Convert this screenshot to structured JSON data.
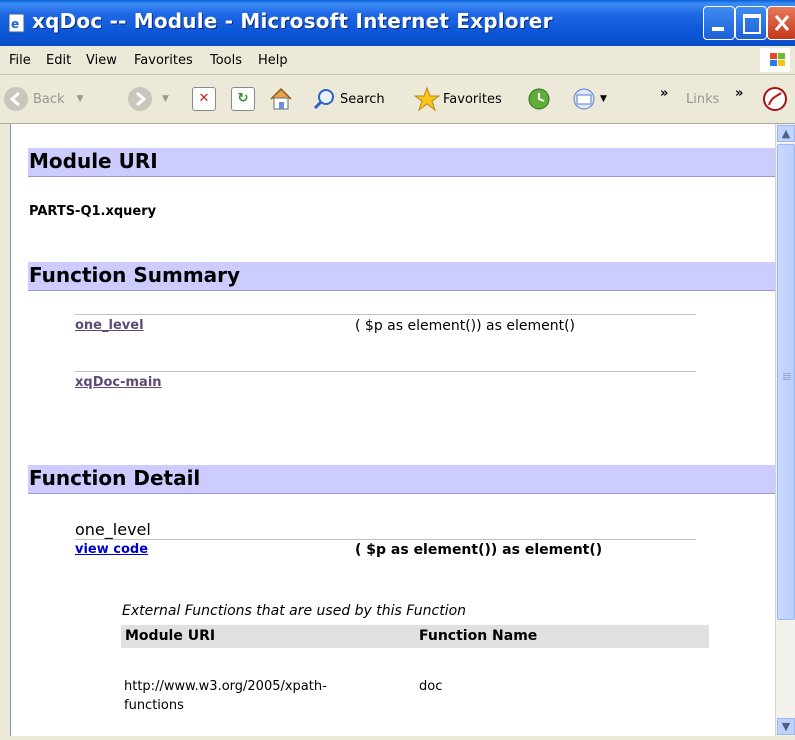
{
  "window": {
    "title": "xqDoc -- Module - Microsoft Internet Explorer"
  },
  "menu": [
    "File",
    "Edit",
    "View",
    "Favorites",
    "Tools",
    "Help"
  ],
  "toolbar": {
    "back": "Back",
    "search": "Search",
    "favorites": "Favorites",
    "links": "Links",
    "chevron": "»"
  },
  "icons": {
    "back": "back-arrow-icon",
    "forward": "forward-arrow-icon",
    "stop": "stop-icon",
    "refresh": "refresh-icon",
    "home": "home-icon",
    "search": "search-icon",
    "favorites": "star-icon",
    "history": "history-icon",
    "mail": "mail-icon",
    "pdf": "pdf-icon"
  },
  "page": {
    "module_uri_heading": "Module URI",
    "module_uri_value": "PARTS-Q1.xquery",
    "function_summary_heading": "Function Summary",
    "summary": [
      {
        "name": "one_level",
        "signature": "( $p as element()) as element()"
      },
      {
        "name": "xqDoc-main",
        "signature": ""
      }
    ],
    "function_detail_heading": "Function Detail",
    "detail": {
      "name": "one_level",
      "view_code": "view code",
      "signature": "( $p as element()) as element()",
      "external_caption": "External Functions that are used by this Function",
      "table_headers": [
        "Module URI",
        "Function Name"
      ],
      "rows": [
        {
          "uri_line1": "http://www.w3.org/2005/xpath-",
          "uri_line2": "functions",
          "function": "doc"
        }
      ]
    }
  },
  "colors": {
    "titlebar": "#0a56d7",
    "section_bar": "#ccccff",
    "visited_link": "#5e4a78",
    "link": "#0000cc",
    "table_header": "#e0e0e0"
  }
}
